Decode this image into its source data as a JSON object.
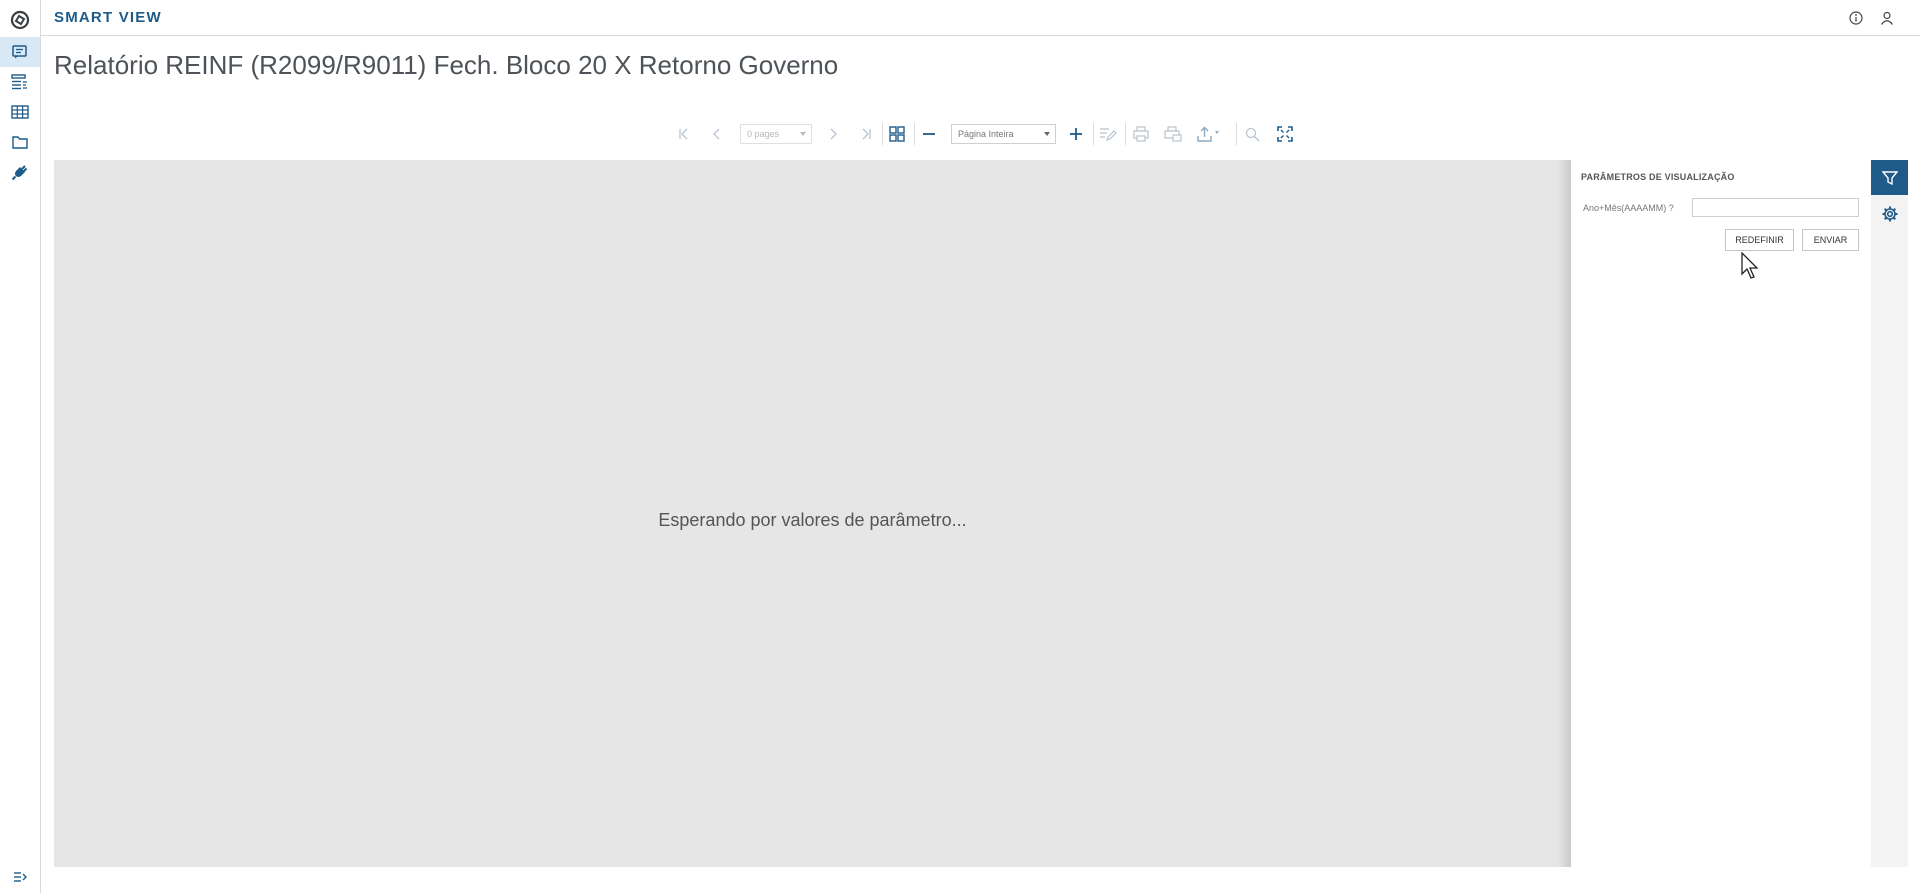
{
  "app": {
    "brand": "SMART VIEW"
  },
  "nav": {
    "items": [
      {
        "name": "logo-icon"
      },
      {
        "name": "reports-icon",
        "active": true
      },
      {
        "name": "list-icon"
      },
      {
        "name": "table-icon"
      },
      {
        "name": "folder-icon"
      },
      {
        "name": "plug-icon"
      },
      {
        "name": "expand-menu-icon"
      }
    ]
  },
  "header": {
    "icons": [
      "info-icon",
      "user-icon"
    ]
  },
  "page": {
    "title": "Relatório REINF (R2099/R9011) Fech. Bloco 20 X Retorno Governo"
  },
  "toolbar": {
    "pages_select": "0 pages",
    "zoom_select": "Página Inteira"
  },
  "viewer": {
    "message": "Esperando por valores de parâmetro..."
  },
  "params": {
    "title": "PARÂMETROS DE VISUALIZAÇÃO",
    "field_label": "Ano+Mês(AAAAMM) ?",
    "field_value": "",
    "reset_label": "REDEFINIR",
    "send_label": "ENVIAR"
  },
  "colors": {
    "accent": "#1f5b88",
    "nav_active_bg": "#d8e9f5",
    "viewer_bg": "#e6e6e6"
  }
}
